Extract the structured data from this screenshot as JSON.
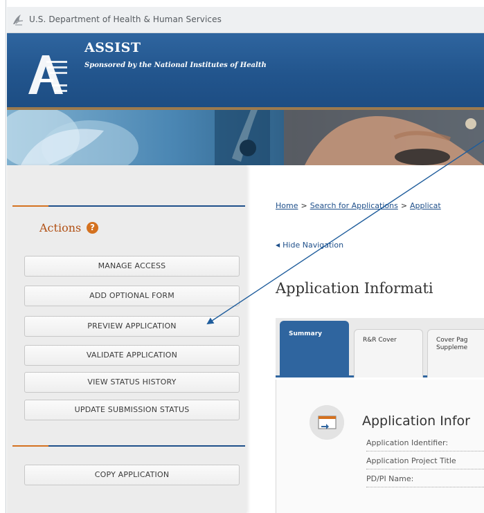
{
  "hhs": {
    "text": "U.S. Department of Health & Human Services"
  },
  "header": {
    "title": "ASSIST",
    "subtitle": "Sponsored by the National Institutes of Health"
  },
  "sidebar": {
    "actions_title": "Actions",
    "help_icon": "?",
    "buttons": [
      "MANAGE ACCESS",
      "ADD OPTIONAL FORM",
      "PREVIEW APPLICATION",
      "VALIDATE APPLICATION",
      "VIEW STATUS HISTORY",
      "UPDATE SUBMISSION STATUS"
    ],
    "copy_button": "COPY APPLICATION"
  },
  "breadcrumb": {
    "items": [
      "Home",
      "Search for Applications",
      "Applicat"
    ],
    "separator": ">"
  },
  "hide_navigation": "Hide Navigation",
  "page_title": "Application Informati",
  "tabs": [
    {
      "line1": "Summary",
      "line2": ""
    },
    {
      "line1": "R&R Cover",
      "line2": ""
    },
    {
      "line1": "Cover Pag",
      "line2": "Suppleme"
    }
  ],
  "section": {
    "title": "Application Infor",
    "fields": [
      "Application Identifier:",
      "Application Project Title",
      "PD/PI Name:"
    ]
  },
  "colors": {
    "header_blue": "#22558d",
    "accent_orange": "#d4711f",
    "actions_title": "#b14f13",
    "annotation_arrow": "#1f5d9c"
  },
  "icons": {
    "hhs_logo": "hhs-eagle-icon",
    "assist_logo": "assist-a-logo",
    "help": "question-circle-icon",
    "section": "window-arrow-icon"
  }
}
